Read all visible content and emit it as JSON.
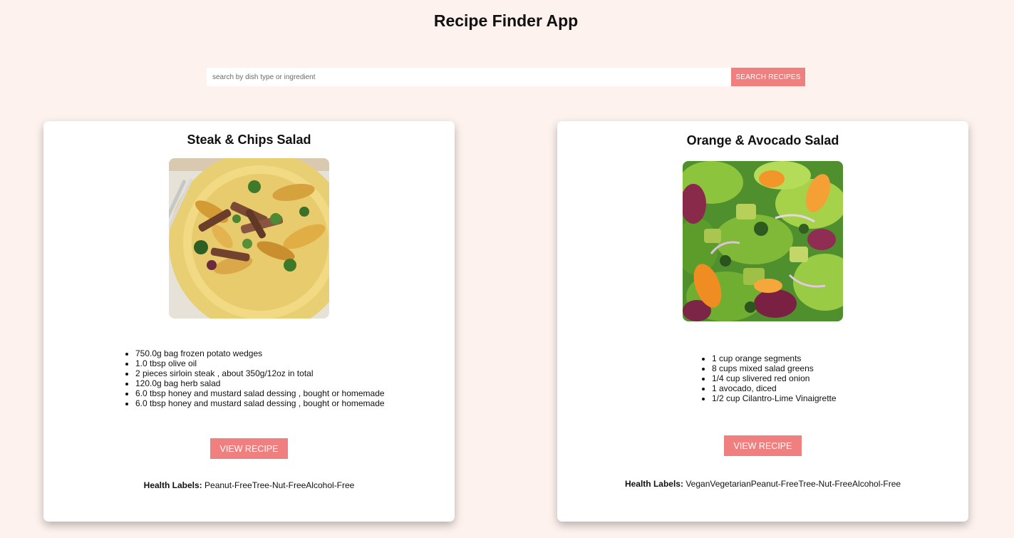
{
  "header": {
    "title": "Recipe Finder App"
  },
  "search": {
    "placeholder": "search by dish type or ingredient",
    "value": "",
    "button_label": "SEARCH RECIPES"
  },
  "colors": {
    "background": "#fdf2ee",
    "accent": "#f08080",
    "card": "#ffffff"
  },
  "recipes": [
    {
      "title": "Steak & Chips Salad",
      "image_icon": "steak-salad-photo",
      "ingredients": [
        "750.0g bag frozen potato wedges",
        "1.0 tbsp olive oil",
        "2 pieces sirloin steak , about 350g/12oz in total",
        "120.0g bag herb salad",
        "6.0 tbsp honey and mustard salad dessing , bought or homemade",
        "6.0 tbsp honey and mustard salad dessing , bought or homemade"
      ],
      "button_label": "VIEW RECIPE",
      "health_label_title": "Health Labels:",
      "health_labels": "Peanut-FreeTree-Nut-FreeAlcohol-Free"
    },
    {
      "title": "Orange & Avocado Salad",
      "image_icon": "orange-avocado-salad-photo",
      "ingredients": [
        "1 cup orange segments",
        "8 cups mixed salad greens",
        "1/4 cup slivered red onion",
        "1 avocado, diced",
        "1/2 cup Cilantro-Lime Vinaigrette"
      ],
      "button_label": "VIEW RECIPE",
      "health_label_title": "Health Labels:",
      "health_labels": "VeganVegetarianPeanut-FreeTree-Nut-FreeAlcohol-Free"
    }
  ]
}
